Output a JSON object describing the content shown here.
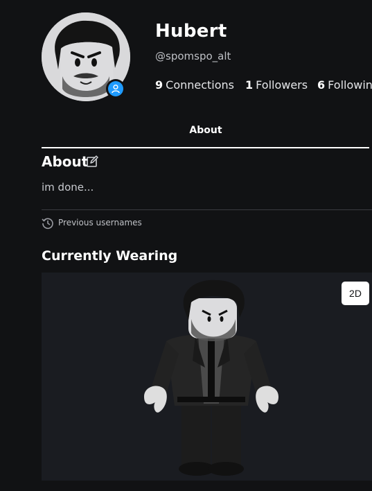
{
  "profile": {
    "display_name": "Hubert",
    "username": "@spomspo_alt",
    "stats": [
      {
        "count": "9",
        "label": "Connections"
      },
      {
        "count": "1",
        "label": "Followers"
      },
      {
        "count": "6",
        "label": "Following"
      }
    ],
    "avatar_icon": "avatar-headshot",
    "status_icon": "user-icon",
    "status_color": "#1f9bff"
  },
  "tabs": {
    "about": "About"
  },
  "about": {
    "heading": "About",
    "edit_icon": "edit-icon",
    "description": "im done...",
    "previous_usernames": "Previous usernames",
    "history_icon": "history-icon"
  },
  "wearing": {
    "heading": "Currently Wearing",
    "toggle_label": "2D"
  }
}
